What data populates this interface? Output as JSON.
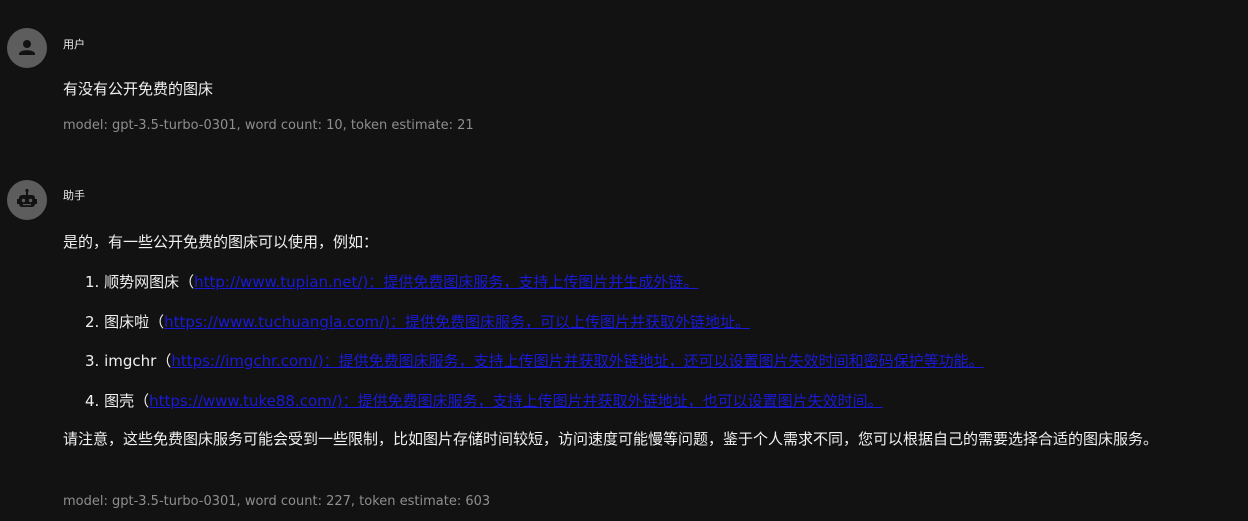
{
  "messages": [
    {
      "role": "用户",
      "avatar_icon": "user-icon",
      "content": "有没有公开免费的图床",
      "meta": "model: gpt-3.5-turbo-0301, word count: 10, token estimate: 21"
    },
    {
      "role": "助手",
      "avatar_icon": "robot-icon",
      "intro": "是的，有一些公开免费的图床可以使用，例如：",
      "items": [
        {
          "num": "1.",
          "name": "顺势网图床（",
          "link": "http://www.tupian.net/)：提供免费图床服务，支持上传图片并生成外链。"
        },
        {
          "num": "2.",
          "name": "图床啦（",
          "link": "https://www.tuchuangla.com/)：提供免费图床服务，可以上传图片并获取外链地址。"
        },
        {
          "num": "3.",
          "name": "imgchr（",
          "link": "https://imgchr.com/)：提供免费图床服务，支持上传图片并获取外链地址，还可以设置图片失效时间和密码保护等功能。"
        },
        {
          "num": "4.",
          "name": "图壳（",
          "link": "https://www.tuke88.com/)：提供免费图床服务，支持上传图片并获取外链地址，也可以设置图片失效时间。"
        }
      ],
      "outro": "请注意，这些免费图床服务可能会受到一些限制，比如图片存储时间较短，访问速度可能慢等问题，鉴于个人需求不同，您可以根据自己的需要选择合适的图床服务。",
      "meta": "model: gpt-3.5-turbo-0301, word count: 227, token estimate: 603"
    }
  ],
  "colors": {
    "background": "#121212",
    "text": "#f0f0f0",
    "meta": "#8e8e8e",
    "link": "#1a1ad6",
    "avatar": "#5d5d5d"
  }
}
